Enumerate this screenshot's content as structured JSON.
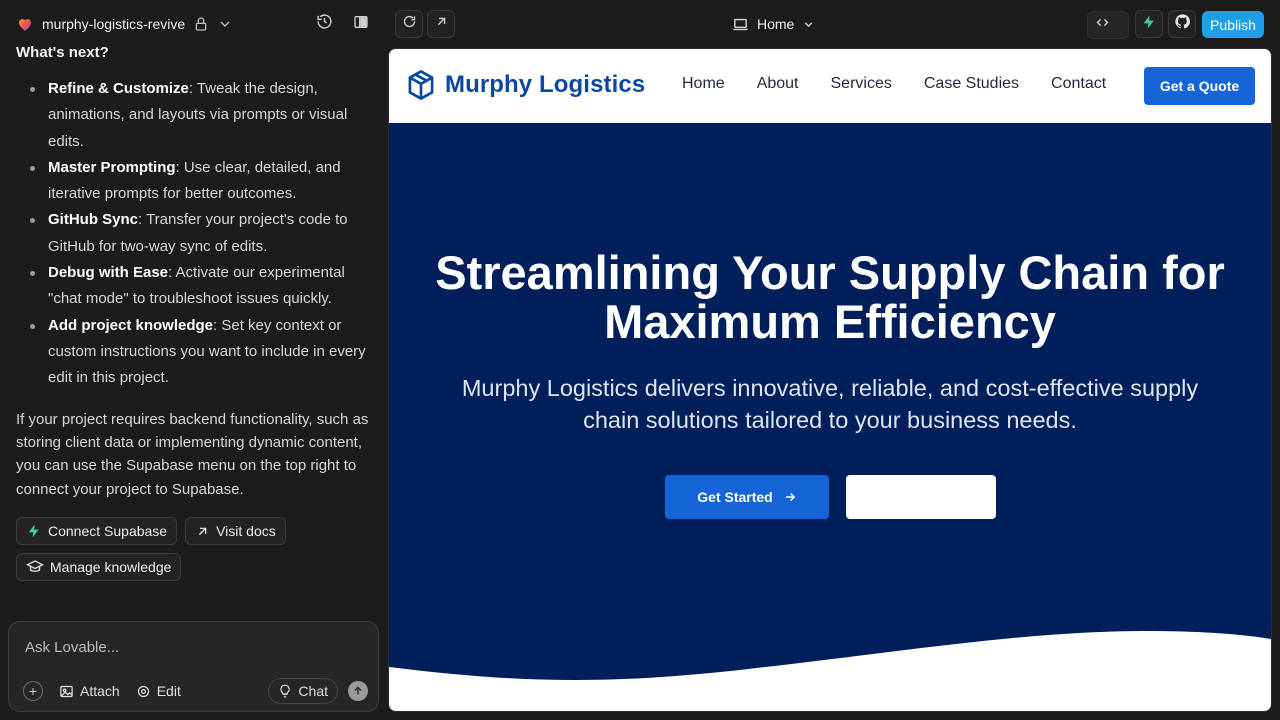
{
  "app": {
    "project_name": "murphy-logistics-revive",
    "route_label": "Home",
    "publish_label": "Publish",
    "accent_publish": "#1f9fe6",
    "logo_colors": [
      "#f5504a",
      "#f8a52b",
      "#6b6cf5"
    ]
  },
  "chat": {
    "heading": "What's next?",
    "tips": [
      {
        "title": "Refine & Customize",
        "text": ": Tweak the design, animations, and layouts via prompts or visual edits."
      },
      {
        "title": "Master Prompting",
        "text": ": Use clear, detailed, and iterative prompts for better outcomes."
      },
      {
        "title": "GitHub Sync",
        "text": ": Transfer your project's code to GitHub for two-way sync of edits."
      },
      {
        "title": "Debug with Ease",
        "text": ": Activate our experimental \"chat mode\" to troubleshoot issues quickly."
      },
      {
        "title": "Add project knowledge",
        "text": ": Set key context or custom instructions you want to include in every edit in this project."
      }
    ],
    "paragraph": "If your project requires backend functionality, such as storing client data or implementing dynamic content, you can use the Supabase menu on the top right to connect your project to Supabase.",
    "chips": {
      "connect": "Connect Supabase",
      "docs": "Visit docs",
      "knowledge": "Manage knowledge"
    }
  },
  "composer": {
    "placeholder": "Ask Lovable...",
    "attach": "Attach",
    "edit": "Edit",
    "chat": "Chat"
  },
  "site": {
    "brand": "Murphy Logistics",
    "brand_color": "#0d47a1",
    "nav": [
      "Home",
      "About",
      "Services",
      "Case Studies",
      "Contact"
    ],
    "cta": "Get a Quote",
    "hero": {
      "title": "Streamlining Your Supply Chain for Maximum Efficiency",
      "subtitle": "Murphy Logistics delivers innovative, reliable, and cost-effective supply chain solutions tailored to your business needs.",
      "primary_button": "Get Started",
      "secondary_button": "",
      "background": "#001f5b"
    }
  }
}
